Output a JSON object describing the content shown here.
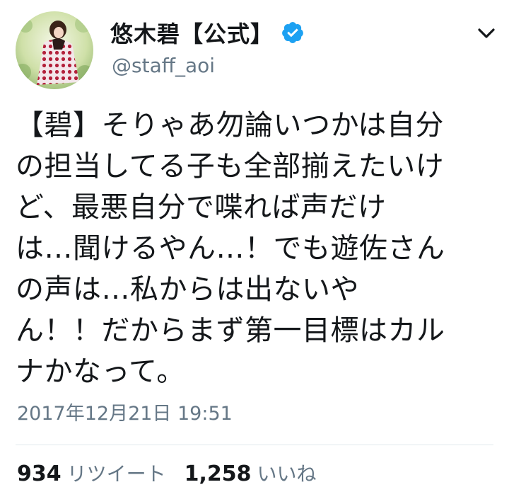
{
  "user": {
    "display_name": "悠木碧【公式】",
    "handle": "@staff_aoi",
    "verified": true,
    "verified_color": "#1da1f2"
  },
  "tweet": {
    "lines": [
      "【碧】そりゃあ勿論いつかは自分",
      "の担当してる子も全部揃えたいけ",
      "ど、最悪自分で喋れば声だけ",
      "は…聞けるやん…！でも遊佐さん",
      "の声は…私からは出ないや",
      "ん！！だからまず第一目標はカル",
      "ナかなって。"
    ],
    "timestamp": "2017年12月21日 19:51"
  },
  "stats": {
    "retweets_count": "934",
    "retweets_label": "リツイート",
    "likes_count": "1,258",
    "likes_label": "いいね"
  },
  "icons": {
    "verified": "verified-badge-icon",
    "menu": "chevron-down-icon"
  }
}
